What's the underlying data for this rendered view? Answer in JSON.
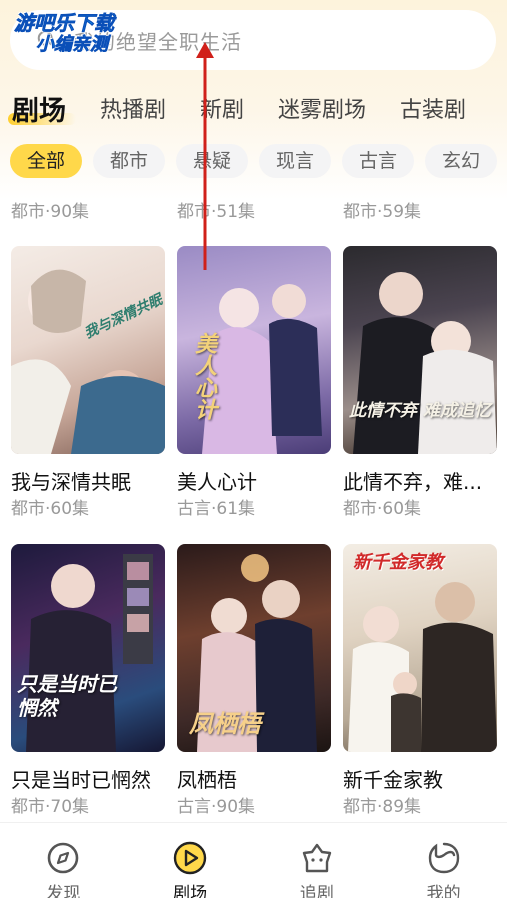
{
  "watermark": {
    "line1": "游吧乐下载",
    "line2": "小编亲测"
  },
  "search": {
    "placeholder": "我的绝望全职生活"
  },
  "tabs": [
    {
      "label": "剧场",
      "active": true
    },
    {
      "label": "热播剧"
    },
    {
      "label": "新剧"
    },
    {
      "label": "迷雾剧场"
    },
    {
      "label": "古装剧"
    }
  ],
  "chips": [
    {
      "label": "全部",
      "active": true
    },
    {
      "label": "都市"
    },
    {
      "label": "悬疑"
    },
    {
      "label": "现言"
    },
    {
      "label": "古言"
    },
    {
      "label": "玄幻"
    }
  ],
  "partial_row": [
    "都市·90集",
    "都市·51集",
    "都市·59集"
  ],
  "dramas": [
    {
      "title": "我与深情共眠",
      "meta": "都市·60集",
      "poster_text": "我与深情共眠"
    },
    {
      "title": "美人心计",
      "meta": "古言·61集",
      "poster_text": "美人心计"
    },
    {
      "title": "此情不弃，难...",
      "meta": "都市·60集",
      "poster_text": "此情不弃 难成追忆"
    },
    {
      "title": "只是当时已惘然",
      "meta": "都市·70集",
      "poster_text": "只是当时已惘然"
    },
    {
      "title": "凤栖梧",
      "meta": "古言·90集",
      "poster_text": "凤栖梧"
    },
    {
      "title": "新千金家教",
      "meta": "都市·89集",
      "poster_text": "新千金家教"
    }
  ],
  "nav": [
    {
      "label": "发现",
      "icon": "compass-icon"
    },
    {
      "label": "剧场",
      "icon": "play-icon",
      "active": true
    },
    {
      "label": "追剧",
      "icon": "follow-icon"
    },
    {
      "label": "我的",
      "icon": "profile-icon"
    }
  ],
  "colors": {
    "accent": "#ffd84a",
    "annotation_arrow": "#d0201a"
  }
}
